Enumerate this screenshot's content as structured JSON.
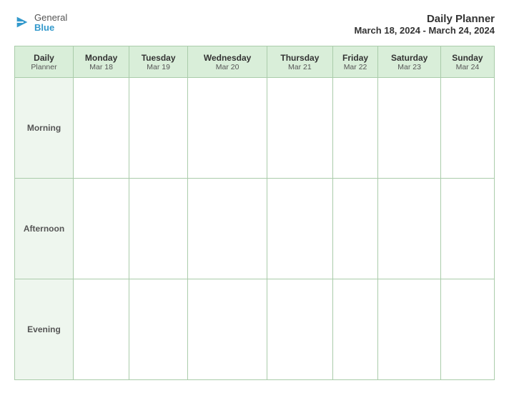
{
  "logo": {
    "general": "General",
    "blue": "Blue"
  },
  "header": {
    "title": "Daily Planner",
    "date_range": "March 18, 2024 - March 24, 2024"
  },
  "table": {
    "first_column_header": "Daily\nPlanner",
    "days": [
      {
        "name": "Monday",
        "date": "Mar 18"
      },
      {
        "name": "Tuesday",
        "date": "Mar 19"
      },
      {
        "name": "Wednesday",
        "date": "Mar 20"
      },
      {
        "name": "Thursday",
        "date": "Mar 21"
      },
      {
        "name": "Friday",
        "date": "Mar 22"
      },
      {
        "name": "Saturday",
        "date": "Mar 23"
      },
      {
        "name": "Sunday",
        "date": "Mar 24"
      }
    ],
    "rows": [
      {
        "label": "Morning"
      },
      {
        "label": "Afternoon"
      },
      {
        "label": "Evening"
      }
    ]
  }
}
